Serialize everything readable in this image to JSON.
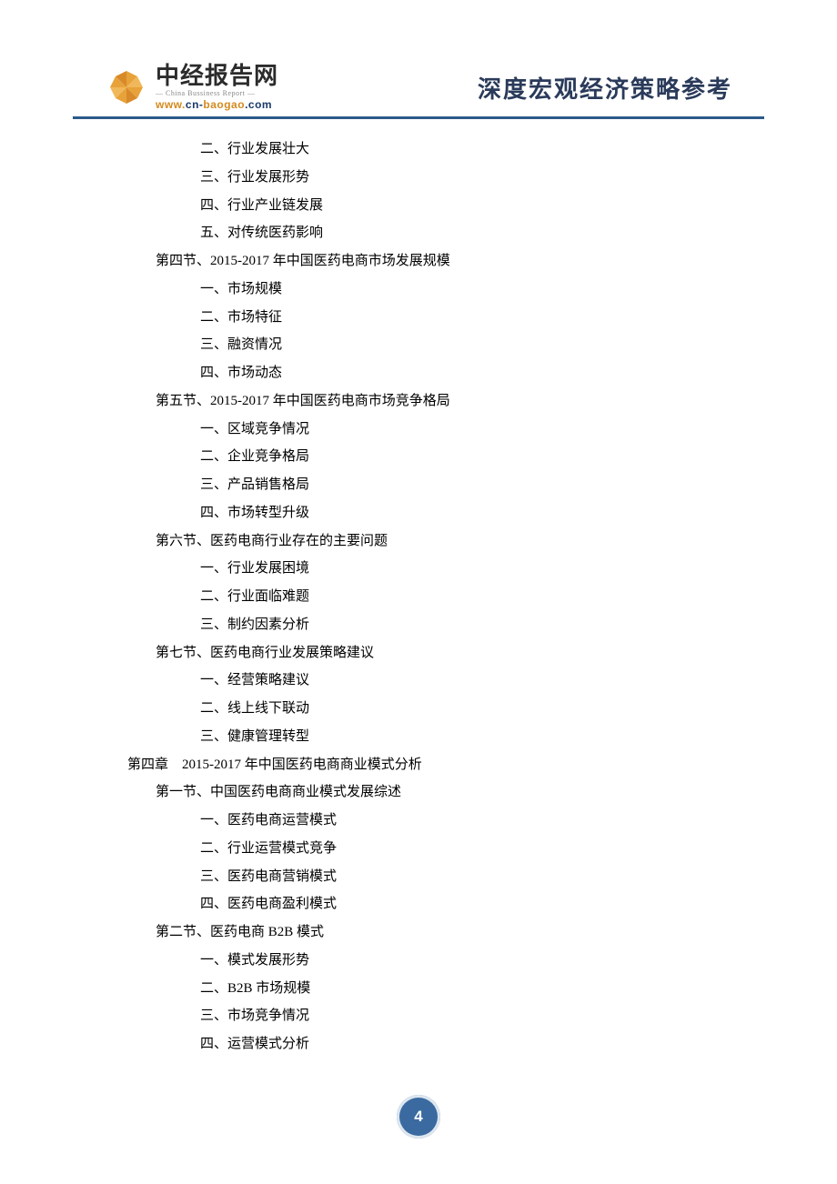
{
  "header": {
    "logo_main": "中经报告网",
    "logo_sub": "— China Bussiness Report —",
    "logo_url_www": "www.",
    "logo_url_cn": "cn-",
    "logo_url_bao": "baogao",
    "logo_url_com": ".com",
    "tagline": "深度宏观经济策略参考"
  },
  "toc": {
    "s3_2": "二、行业发展壮大",
    "s3_3": "三、行业发展形势",
    "s3_4": "四、行业产业链发展",
    "s3_5": "五、对传统医药影响",
    "s4": "第四节、2015-2017 年中国医药电商市场发展规模",
    "s4_1": "一、市场规模",
    "s4_2": "二、市场特征",
    "s4_3": "三、融资情况",
    "s4_4": "四、市场动态",
    "s5": "第五节、2015-2017 年中国医药电商市场竞争格局",
    "s5_1": "一、区域竞争情况",
    "s5_2": "二、企业竞争格局",
    "s5_3": "三、产品销售格局",
    "s5_4": "四、市场转型升级",
    "s6": "第六节、医药电商行业存在的主要问题",
    "s6_1": "一、行业发展困境",
    "s6_2": "二、行业面临难题",
    "s6_3": "三、制约因素分析",
    "s7": "第七节、医药电商行业发展策略建议",
    "s7_1": "一、经营策略建议",
    "s7_2": "二、线上线下联动",
    "s7_3": "三、健康管理转型",
    "ch4": "第四章　2015-2017 年中国医药电商商业模式分析",
    "c4s1": "第一节、中国医药电商商业模式发展综述",
    "c4s1_1": "一、医药电商运营模式",
    "c4s1_2": "二、行业运营模式竞争",
    "c4s1_3": "三、医药电商营销模式",
    "c4s1_4": "四、医药电商盈利模式",
    "c4s2": "第二节、医药电商 B2B 模式",
    "c4s2_1": "一、模式发展形势",
    "c4s2_2": "二、B2B 市场规模",
    "c4s2_3": "三、市场竞争情况",
    "c4s2_4": "四、运营模式分析"
  },
  "page_num": "4"
}
